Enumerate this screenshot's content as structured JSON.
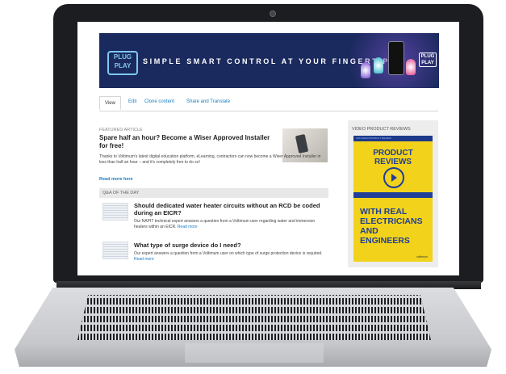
{
  "banner": {
    "logo_top": "PLUG",
    "logo_bottom": "PLAY",
    "tagline": "SIMPLE SMART CONTROL AT YOUR FINGERTIPS",
    "badge_top": "PLUG",
    "badge_bottom": "PLAY"
  },
  "tabs": [
    {
      "label": "View",
      "active": true
    },
    {
      "label": "Edit"
    },
    {
      "label": "Clone content"
    },
    {
      "label": "Share and Translate"
    }
  ],
  "featured": {
    "label": "FEATURED ARTICLE",
    "title": "Spare half an hour? Become a Wiser Approved Installer for free!",
    "body": "Thanks to Voltimum's latest digital education platform, eLearning, contractors can now become a Wiser Approved Installer in less than half an hour – and it's completely free to do so!",
    "more": "Read more here"
  },
  "qa": {
    "label": "Q&A OF THE DAY",
    "items": [
      {
        "title": "Should dedicated water heater circuits without an RCD be coded during an EICR?",
        "body": "Our NAPIT technical expert answers a question from a Voltimum user regarding water and immersion heaters within an EICR.",
        "more": "Read more"
      },
      {
        "title": "What type of surge device do I need?",
        "body": "Our expert answers a question from a Voltimum user on which type of surge protection device is required.",
        "more": "Read more"
      }
    ]
  },
  "sidebar": {
    "label": "VIDEO PRODUCT REVIEWS",
    "video_top": "VOLTIMUM PRODUCT REVIEW",
    "headline1": "PRODUCT REVIEWS",
    "headline2": "WITH REAL ELECTRICIANS AND ENGINEERS",
    "brand": "voltimum"
  },
  "colors": {
    "banner_bg": "#1b2a5e",
    "link": "#1a7bc0",
    "video_bg": "#f2d21a",
    "video_text": "#1f3f99"
  }
}
